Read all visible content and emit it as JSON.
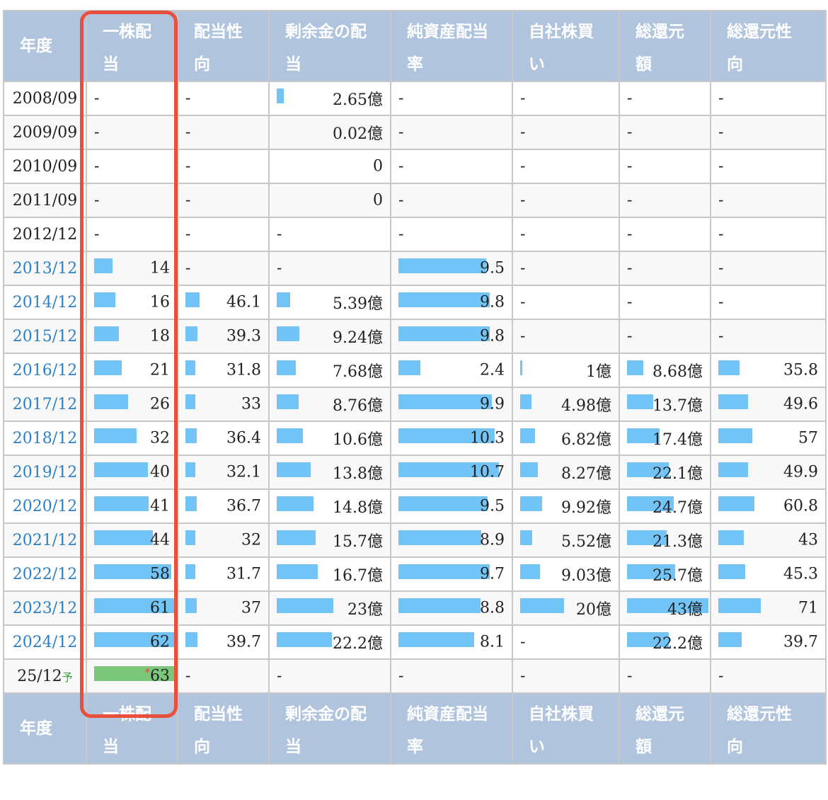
{
  "headers": {
    "year": "年度",
    "cols": [
      [
        "一株配",
        "当"
      ],
      [
        "配当性",
        "向"
      ],
      [
        "剰余金の配",
        "当"
      ],
      [
        "純資産配当",
        "率"
      ],
      [
        "自社株買",
        "い"
      ],
      [
        "総還元",
        "額"
      ],
      [
        "総還元性",
        "向"
      ]
    ]
  },
  "colors": {
    "bar": "#72c4f6",
    "forecast_bar": "#7cc87a",
    "header_bg": "#b0c4de",
    "highlight": "#e8503c",
    "link": "#2d7fc1"
  },
  "rows": [
    {
      "year": "2008/09",
      "link": false,
      "cells": [
        null,
        null,
        {
          "v": "2.65億",
          "f": 0.12
        },
        null,
        null,
        null,
        null
      ]
    },
    {
      "year": "2009/09",
      "link": false,
      "cells": [
        null,
        null,
        {
          "v": "0.02億",
          "f": 0
        },
        null,
        null,
        null,
        null
      ]
    },
    {
      "year": "2010/09",
      "link": false,
      "cells": [
        null,
        null,
        {
          "v": "0",
          "f": 0
        },
        null,
        null,
        null,
        null
      ]
    },
    {
      "year": "2011/09",
      "link": false,
      "cells": [
        null,
        null,
        {
          "v": "0",
          "f": 0
        },
        null,
        null,
        null,
        null
      ]
    },
    {
      "year": "2012/12",
      "link": false,
      "cells": [
        null,
        null,
        null,
        null,
        null,
        null,
        null
      ]
    },
    {
      "year": "2013/12",
      "link": true,
      "cells": [
        {
          "v": "14",
          "f": 0.23
        },
        null,
        null,
        {
          "v": "9.5",
          "f": 0.87
        },
        null,
        null,
        null
      ]
    },
    {
      "year": "2014/12",
      "link": true,
      "cells": [
        {
          "v": "16",
          "f": 0.26
        },
        {
          "v": "46.1",
          "f": 0.42
        },
        {
          "v": "5.39億",
          "f": 0.23
        },
        {
          "v": "9.8",
          "f": 0.9
        },
        null,
        null,
        null
      ]
    },
    {
      "year": "2015/12",
      "link": true,
      "cells": [
        {
          "v": "18",
          "f": 0.3
        },
        {
          "v": "39.3",
          "f": 0.36
        },
        {
          "v": "9.24億",
          "f": 0.39
        },
        {
          "v": "9.8",
          "f": 0.9
        },
        null,
        null,
        null
      ]
    },
    {
      "year": "2016/12",
      "link": true,
      "cells": [
        {
          "v": "21",
          "f": 0.34
        },
        {
          "v": "31.8",
          "f": 0.29
        },
        {
          "v": "7.68億",
          "f": 0.33
        },
        {
          "v": "2.4",
          "f": 0.22
        },
        {
          "v": "1億",
          "f": 0.02
        },
        {
          "v": "8.68億",
          "f": 0.2
        },
        {
          "v": "35.8",
          "f": 0.35
        }
      ]
    },
    {
      "year": "2017/12",
      "link": true,
      "cells": [
        {
          "v": "26",
          "f": 0.42
        },
        {
          "v": "33",
          "f": 0.3
        },
        {
          "v": "8.76億",
          "f": 0.38
        },
        {
          "v": "9.9",
          "f": 0.92
        },
        {
          "v": "4.98億",
          "f": 0.25
        },
        {
          "v": "13.7億",
          "f": 0.32
        },
        {
          "v": "49.6",
          "f": 0.49
        }
      ]
    },
    {
      "year": "2018/12",
      "link": true,
      "cells": [
        {
          "v": "32",
          "f": 0.52
        },
        {
          "v": "36.4",
          "f": 0.33
        },
        {
          "v": "10.6億",
          "f": 0.45
        },
        {
          "v": "10.3",
          "f": 0.95
        },
        {
          "v": "6.82億",
          "f": 0.32
        },
        {
          "v": "17.4億",
          "f": 0.4
        },
        {
          "v": "57",
          "f": 0.56
        }
      ]
    },
    {
      "year": "2019/12",
      "link": true,
      "cells": [
        {
          "v": "40",
          "f": 0.66
        },
        {
          "v": "32.1",
          "f": 0.29
        },
        {
          "v": "13.8億",
          "f": 0.59
        },
        {
          "v": "10.7",
          "f": 0.99
        },
        {
          "v": "8.27億",
          "f": 0.39
        },
        {
          "v": "22.1億",
          "f": 0.51
        },
        {
          "v": "49.9",
          "f": 0.49
        }
      ]
    },
    {
      "year": "2020/12",
      "link": true,
      "cells": [
        {
          "v": "41",
          "f": 0.67
        },
        {
          "v": "36.7",
          "f": 0.34
        },
        {
          "v": "14.8億",
          "f": 0.63
        },
        {
          "v": "9.5",
          "f": 0.88
        },
        {
          "v": "9.92億",
          "f": 0.47
        },
        {
          "v": "24.7億",
          "f": 0.57
        },
        {
          "v": "60.8",
          "f": 0.6
        }
      ]
    },
    {
      "year": "2021/12",
      "link": true,
      "cells": [
        {
          "v": "44",
          "f": 0.72
        },
        {
          "v": "32",
          "f": 0.29
        },
        {
          "v": "15.7億",
          "f": 0.67
        },
        {
          "v": "8.9",
          "f": 0.82
        },
        {
          "v": "5.52億",
          "f": 0.26
        },
        {
          "v": "21.3億",
          "f": 0.49
        },
        {
          "v": "43",
          "f": 0.42
        }
      ]
    },
    {
      "year": "2022/12",
      "link": true,
      "cells": [
        {
          "v": "58",
          "f": 0.95
        },
        {
          "v": "31.7",
          "f": 0.29
        },
        {
          "v": "16.7億",
          "f": 0.71
        },
        {
          "v": "9.7",
          "f": 0.9
        },
        {
          "v": "9.03億",
          "f": 0.43
        },
        {
          "v": "25.7億",
          "f": 0.59
        },
        {
          "v": "45.3",
          "f": 0.45
        }
      ]
    },
    {
      "year": "2023/12",
      "link": true,
      "cells": [
        {
          "v": "61",
          "f": 1.0
        },
        {
          "v": "37",
          "f": 0.34
        },
        {
          "v": "23億",
          "f": 0.98
        },
        {
          "v": "8.8",
          "f": 0.81
        },
        {
          "v": "20億",
          "f": 0.95
        },
        {
          "v": "43億",
          "f": 1.0
        },
        {
          "v": "71",
          "f": 0.7
        }
      ]
    },
    {
      "year": "2024/12",
      "link": true,
      "cells": [
        {
          "v": "62",
          "f": 1.0
        },
        {
          "v": "39.7",
          "f": 0.36
        },
        {
          "v": "22.2億",
          "f": 0.95
        },
        {
          "v": "8.1",
          "f": 0.75
        },
        null,
        {
          "v": "22.2億",
          "f": 0.51
        },
        {
          "v": "39.7",
          "f": 0.39
        }
      ]
    },
    {
      "year": "25/12",
      "yosoku": "予",
      "link": false,
      "forecast": true,
      "cells": [
        {
          "v": "63",
          "f": 1.0,
          "star": "*"
        },
        null,
        null,
        null,
        null,
        null,
        null
      ]
    }
  ]
}
